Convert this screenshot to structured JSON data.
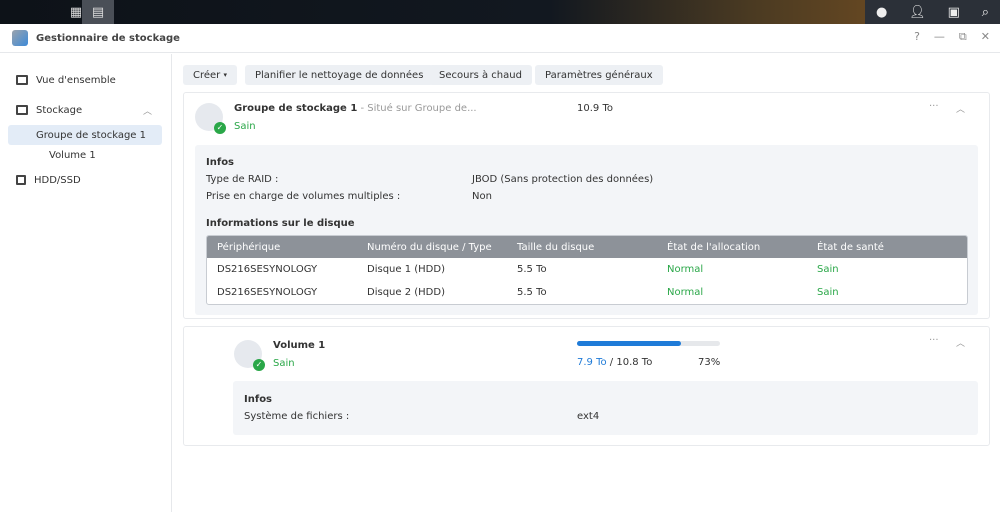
{
  "taskbar": {
    "icons": [
      "main-menu-icon",
      "storage-manager-icon"
    ],
    "right_icons": [
      "chat-icon",
      "user-icon",
      "widgets-icon",
      "search-icon"
    ]
  },
  "window": {
    "title": "Gestionnaire de stockage",
    "controls": {
      "help": "?",
      "minimize": "—",
      "restore": "⧉",
      "close": "✕"
    }
  },
  "sidebar": {
    "items": [
      {
        "label": "Vue d'ensemble"
      },
      {
        "label": "Stockage"
      },
      {
        "label": "Groupe de stockage 1"
      },
      {
        "label": "Volume 1"
      },
      {
        "label": "HDD/SSD"
      }
    ]
  },
  "toolbar": {
    "create": "Créer",
    "schedule": "Planifier le nettoyage de données",
    "hotspare": "Secours à chaud",
    "settings": "Paramètres généraux"
  },
  "pool": {
    "name": "Groupe de stockage 1",
    "location": " - Situé sur Groupe de...",
    "status": "Sain",
    "size": "10.9 To",
    "info_title": "Infos",
    "raid_label": "Type de RAID :",
    "raid_value": "JBOD (Sans protection des données)",
    "multi_label": "Prise en charge de volumes multiples :",
    "multi_value": "Non",
    "disks_title": "Informations sur le disque",
    "columns": [
      "Périphérique",
      "Numéro du disque / Type",
      "Taille du disque",
      "État de l'allocation",
      "État de santé"
    ],
    "rows": [
      [
        "DS216SESYNOLOGY",
        "Disque 1 (HDD)",
        "5.5 To",
        "Normal",
        "Sain"
      ],
      [
        "DS216SESYNOLOGY",
        "Disque 2 (HDD)",
        "5.5 To",
        "Normal",
        "Sain"
      ]
    ]
  },
  "volume": {
    "name": "Volume 1",
    "status": "Sain",
    "used": "7.9 To",
    "sep": " / ",
    "total": "10.8 To",
    "percent_label": "73%",
    "percent": 73,
    "info_title": "Infos",
    "fs_label": "Système de fichiers :",
    "fs_value": "ext4"
  },
  "colors": {
    "accent": "#1f7bd8",
    "healthy": "#2aa748"
  }
}
